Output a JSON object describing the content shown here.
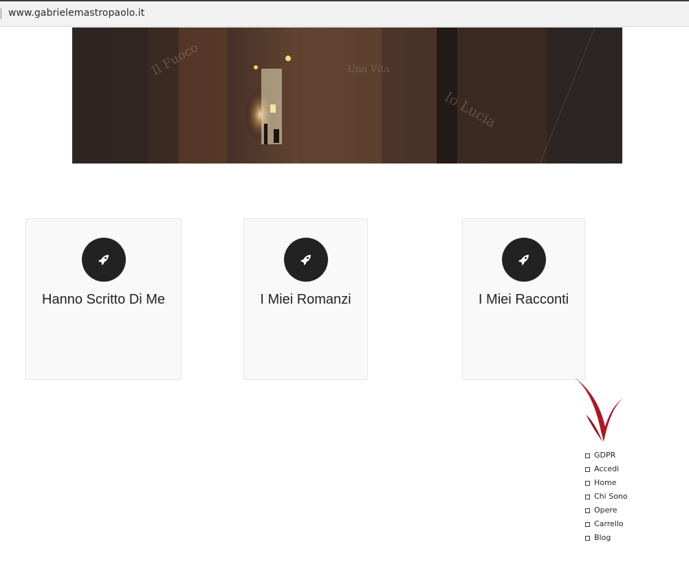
{
  "browser": {
    "url": "www.gabrielemastropaolo.it"
  },
  "hero": {
    "overlay_texts": [
      "Il Fuoco",
      "Io Lucia",
      "Una Vita"
    ]
  },
  "cards": [
    {
      "title": "Hanno Scritto Di Me",
      "icon": "rocket-icon"
    },
    {
      "title": "I Miei Romanzi",
      "icon": "rocket-icon"
    },
    {
      "title": "I Miei Racconti",
      "icon": "rocket-icon"
    }
  ],
  "colors": {
    "card_bg": "#f9f9f9",
    "circle": "#222222",
    "arrow": "#b31524"
  },
  "menu": {
    "items": [
      "GDPR",
      "Accedi",
      "Home",
      "Chi Sono",
      "Opere",
      "Carrello",
      "Blog"
    ]
  }
}
